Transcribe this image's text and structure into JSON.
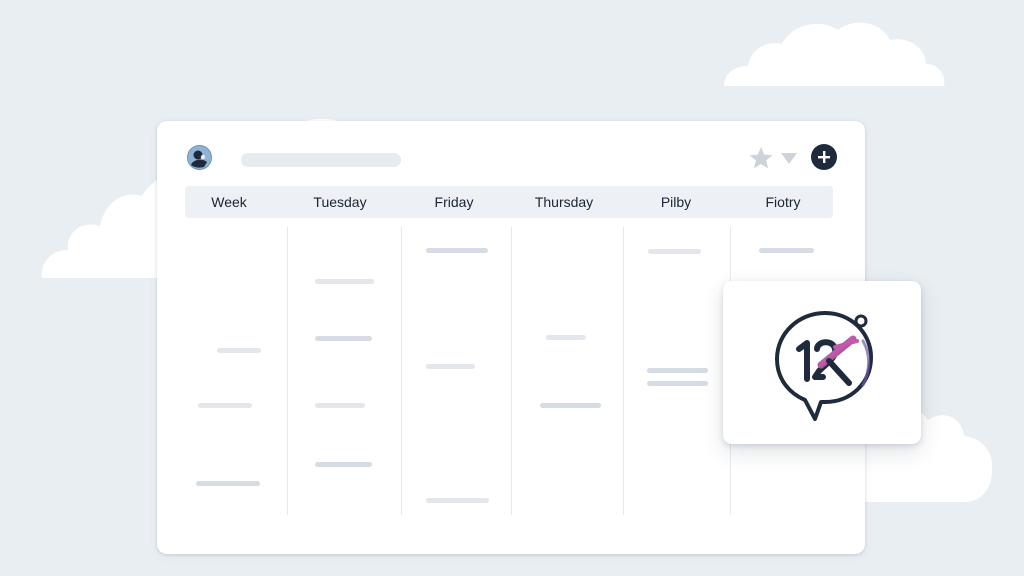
{
  "app": {
    "theme": {
      "background": "#e9eef3",
      "window": "#ffffff",
      "header_row": "#edf0f4",
      "accent_dark": "#1f2a3c",
      "event_bar": "#d6dce3"
    }
  },
  "toolbar": {
    "avatar_icon": "user-avatar-icon",
    "star_icon": "star-icon",
    "dropdown_icon": "chevron-down-icon",
    "add_icon": "plus-icon"
  },
  "calendar": {
    "columns": [
      {
        "label": "Week"
      },
      {
        "label": "Tuesday"
      },
      {
        "label": "Friday"
      },
      {
        "label": "Thursday"
      },
      {
        "label": "Pilby"
      },
      {
        "label": "Fiotry"
      }
    ]
  },
  "card": {
    "logo_icon": "chat-bubble-logo-icon"
  }
}
